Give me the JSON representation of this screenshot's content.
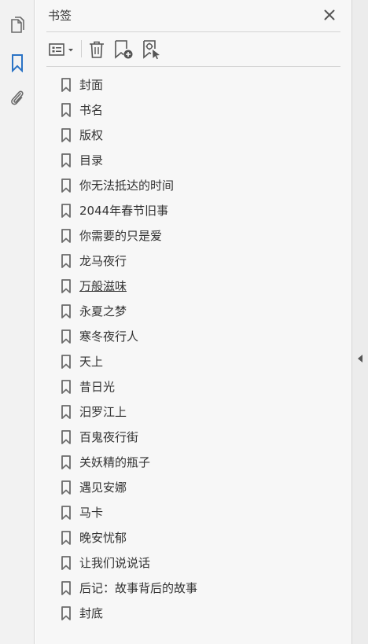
{
  "panel": {
    "title": "书签"
  },
  "rail": {
    "items": [
      {
        "icon": "pages-icon",
        "active": false
      },
      {
        "icon": "bookmark-icon",
        "active": true
      },
      {
        "icon": "paperclip-icon",
        "active": false
      }
    ]
  },
  "toolbar": {
    "buttons": [
      "options-menu-icon",
      "delete-icon",
      "new-bookmark-icon",
      "new-bookmark-from-structure-icon"
    ]
  },
  "bookmarks": [
    "封面",
    "书名",
    "版权",
    "目录",
    "你无法抵达的时间",
    "2044年春节旧事",
    "你需要的只是爱",
    "龙马夜行",
    "万般滋味",
    "永夏之梦",
    "寒冬夜行人",
    "天上",
    "昔日光",
    "汨罗江上",
    "百鬼夜行街",
    "关妖精的瓶子",
    "遇见安娜",
    "马卡",
    "晚安忧郁",
    "让我们说说话",
    "后记：故事背后的故事",
    "封底"
  ],
  "hovered_index": 8,
  "colors": {
    "accent": "#2a73c5",
    "icon": "#6b6b6b"
  }
}
